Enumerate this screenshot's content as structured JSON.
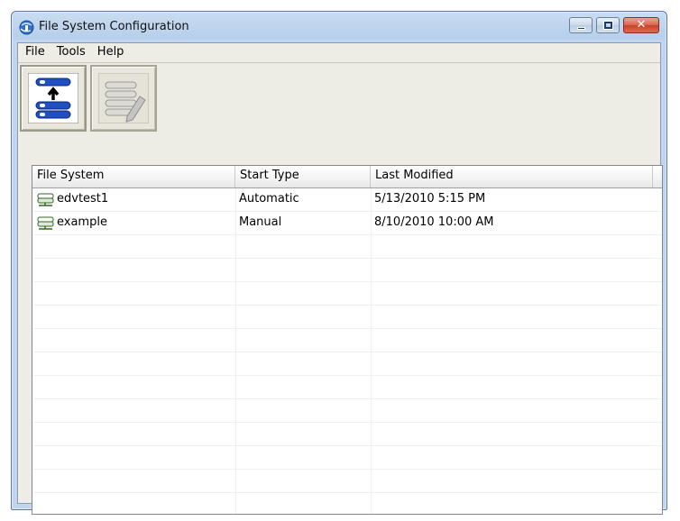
{
  "window": {
    "title": "File System Configuration"
  },
  "menu": {
    "items": [
      "File",
      "Tools",
      "Help"
    ]
  },
  "toolbar": {
    "buttons": [
      {
        "icon": "add-filesystem-icon",
        "enabled": true
      },
      {
        "icon": "edit-filesystem-icon",
        "enabled": false
      }
    ]
  },
  "list": {
    "columns": [
      "File System",
      "Start Type",
      "Last Modified"
    ],
    "rows": [
      {
        "name": "edvtest1",
        "start_type": "Automatic",
        "last_modified": "5/13/2010 5:15 PM",
        "icon": "filesystem-icon"
      },
      {
        "name": "example",
        "start_type": "Manual",
        "last_modified": "8/10/2010 10:00 AM",
        "icon": "filesystem-icon"
      }
    ]
  },
  "colors": {
    "titlebar": "#b7cfea",
    "client": "#eeede5",
    "accent_blue": "#1f4fc0",
    "close": "#d9644b"
  }
}
